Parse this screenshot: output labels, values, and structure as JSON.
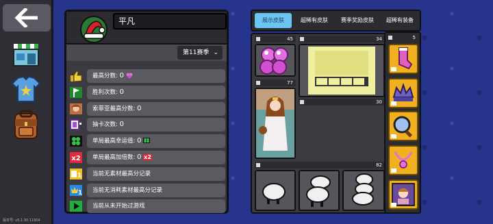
{
  "nav": {
    "back_icon": "back-arrow-icon",
    "items": [
      {
        "name": "shop",
        "icon": "shop-icon"
      },
      {
        "name": "skins",
        "icon": "shirt-icon"
      },
      {
        "name": "inventory",
        "icon": "backpack-icon"
      }
    ],
    "version": "版本号: v5.1.90.11904"
  },
  "profile": {
    "name": "平凡",
    "season_label": "第11赛季",
    "season_icon": "chevron-down-icon",
    "stats": [
      {
        "label": "最高分数: ",
        "value": "0",
        "icon": "thumbs-up-icon",
        "suffix_icon": "flower-icon"
      },
      {
        "label": "胜利次数: ",
        "value": "0",
        "icon": "flag-icon",
        "suffix_icon": ""
      },
      {
        "label": "索菲亚最高分数: ",
        "value": "0",
        "icon": "sofia-portrait-icon",
        "suffix_icon": ""
      },
      {
        "label": "抽卡次数: ",
        "value": "0",
        "icon": "card-draw-icon",
        "suffix_icon": ""
      },
      {
        "label": "单局最高幸运值: ",
        "value": "0",
        "icon": "clover-icon",
        "suffix_icon": "clover-small-icon"
      },
      {
        "label": "单局最高加倍数: ",
        "value": "0",
        "icon": "multiplier-icon",
        "suffix_icon": "x2-badge-icon",
        "suffix_text": "x2"
      },
      {
        "label": "当前无素材最高分记录",
        "value": "",
        "icon": "no-material-icon",
        "suffix_icon": ""
      },
      {
        "label": "当前无消耗素材最高分记录",
        "value": "",
        "icon": "no-consume-icon",
        "suffix_icon": ""
      },
      {
        "label": "当前从未开始过游戏",
        "value": "",
        "icon": "play-icon",
        "suffix_icon": ""
      }
    ]
  },
  "tabs": [
    {
      "label": "展示皮肤",
      "active": true
    },
    {
      "label": "超稀有皮肤",
      "active": false
    },
    {
      "label": "赛季奖励皮肤",
      "active": false
    },
    {
      "label": "超稀有装备",
      "active": false
    }
  ],
  "slots": {
    "counts": {
      "pink_ball": "45",
      "yellow_frame": "34",
      "character": "77",
      "middle": "30",
      "sheep": "82",
      "side": "5"
    }
  },
  "colors": {
    "accent_tab": "#6cc4f0",
    "side_gold": "#f0b020",
    "background": "#26348e"
  }
}
